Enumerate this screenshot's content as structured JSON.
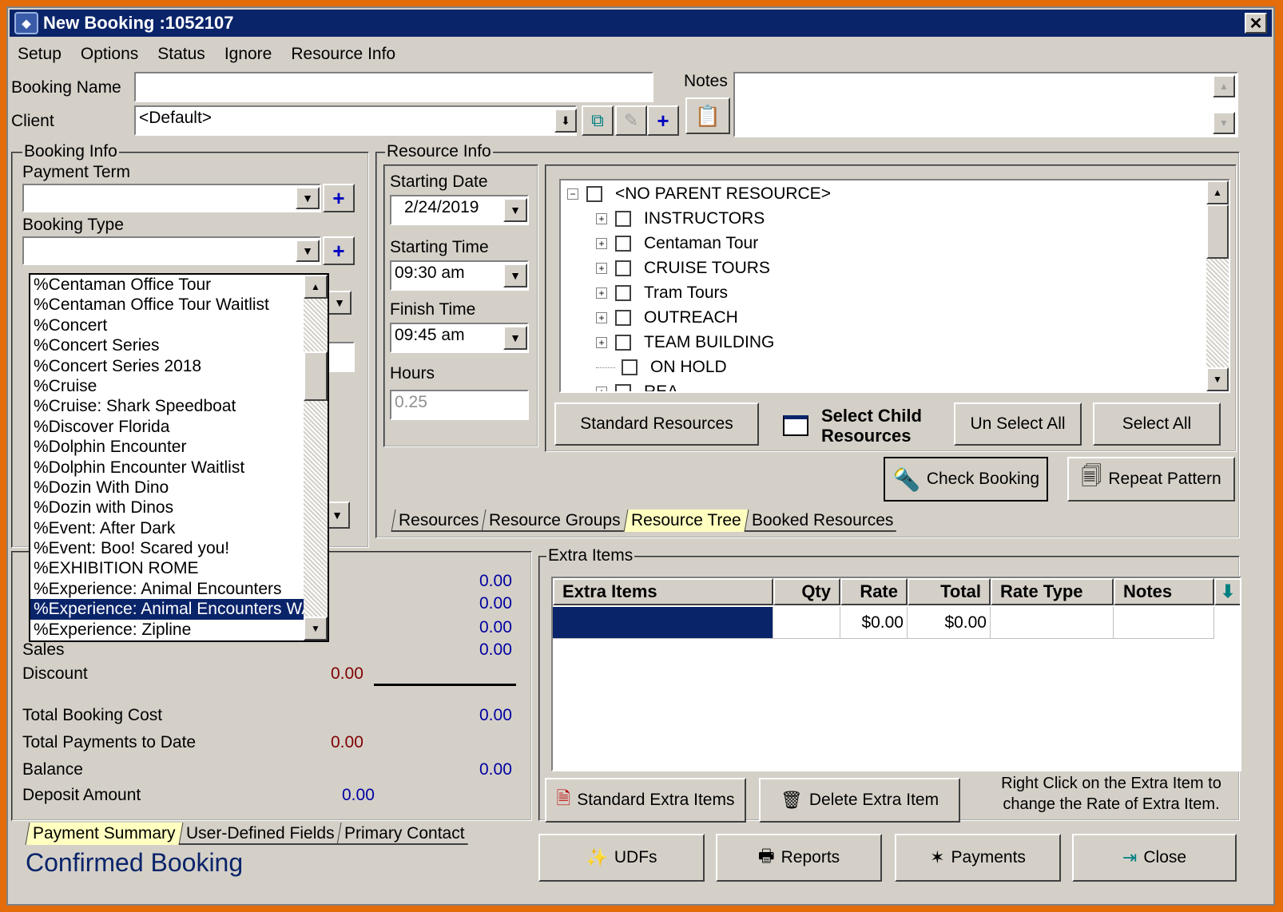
{
  "window": {
    "title": "New Booking :1052107",
    "close": "✕"
  },
  "menu": [
    "Setup",
    "Options",
    "Status",
    "Ignore",
    "Resource Info"
  ],
  "header": {
    "booking_name_label": "Booking Name",
    "booking_name_value": "",
    "client_label": "Client",
    "client_value": "<Default>",
    "notes_label": "Notes"
  },
  "booking_info": {
    "title": "Booking Info",
    "payment_term_label": "Payment Term",
    "payment_term_value": "",
    "booking_type_label": "Booking Type",
    "booking_type_value": ""
  },
  "booking_type_options": [
    "%Centaman Office Tour",
    "%Centaman Office Tour Waitlist",
    "%Concert",
    "%Concert Series",
    "%Concert Series 2018",
    "%Cruise",
    "%Cruise: Shark Speedboat",
    "%Discover Florida",
    "%Dolphin Encounter",
    "%Dolphin Encounter Waitlist",
    "%Dozin With Dino",
    "%Dozin with Dinos",
    "%Event: After Dark",
    "%Event: Boo! Scared you!",
    "%EXHIBITION ROME",
    "%Experience: Animal Encounters",
    "%Experience: Animal Encounters WA",
    "%Experience: Zipline"
  ],
  "booking_type_selected_index": 16,
  "resource_info": {
    "title": "Resource Info",
    "starting_date_label": "Starting Date",
    "starting_date": "2/24/2019",
    "starting_time_label": "Starting Time",
    "starting_time": "09:30 am",
    "finish_time_label": "Finish Time",
    "finish_time": "09:45 am",
    "hours_label": "Hours",
    "hours": "0.25"
  },
  "tree": {
    "root": "<NO PARENT RESOURCE>",
    "children": [
      "INSTRUCTORS",
      "Centaman Tour",
      "CRUISE TOURS",
      "Tram Tours",
      "OUTREACH",
      "TEAM BUILDING",
      "ON HOLD",
      "REA"
    ]
  },
  "resource_buttons": {
    "standard": "Standard Resources",
    "select_child": "Select Child Resources",
    "unselect_all": "Un Select All",
    "select_all": "Select All",
    "check_booking": "Check Booking",
    "repeat_pattern": "Repeat Pattern"
  },
  "resource_tabs": [
    "Resources",
    "Resource Groups",
    "Resource Tree",
    "Booked Resources"
  ],
  "resource_tab_active": "Resource Tree",
  "summary": {
    "hidden_values": [
      "0.00",
      "0.00",
      "0.00"
    ],
    "sales_label": "Sales",
    "sales": "0.00",
    "discount_label": "Discount",
    "discount": "0.00",
    "total_cost_label": "Total Booking Cost",
    "total_cost": "0.00",
    "total_payments_label": "Total Payments to Date",
    "total_payments": "0.00",
    "balance_label": "Balance",
    "balance": "0.00",
    "deposit_label": "Deposit Amount",
    "deposit": "0.00"
  },
  "bottom_tabs": [
    "Payment Summary",
    "User-Defined Fields",
    "Primary Contact"
  ],
  "bottom_tab_active": "Payment Summary",
  "status_text": "Confirmed Booking",
  "extra_items": {
    "title": "Extra Items",
    "columns": [
      "Extra Items",
      "Qty",
      "Rate",
      "Total",
      "Rate Type",
      "Notes"
    ],
    "rows": [
      {
        "item": "",
        "qty": "",
        "rate": "$0.00",
        "total": "$0.00",
        "rate_type": "",
        "notes": ""
      }
    ],
    "standard_btn": "Standard Extra Items",
    "delete_btn": "Delete Extra Item",
    "hint": "Right Click on the Extra Item to change the Rate of Extra Item."
  },
  "footer_buttons": {
    "udfs": "UDFs",
    "reports": "Reports",
    "payments": "Payments",
    "close": "Close"
  },
  "colors": {
    "title_bar": "#0a246a",
    "face": "#d4d0c8",
    "accent_blue": "#0000a0",
    "accent_red": "#800000",
    "active_tab": "#ffffc0"
  }
}
